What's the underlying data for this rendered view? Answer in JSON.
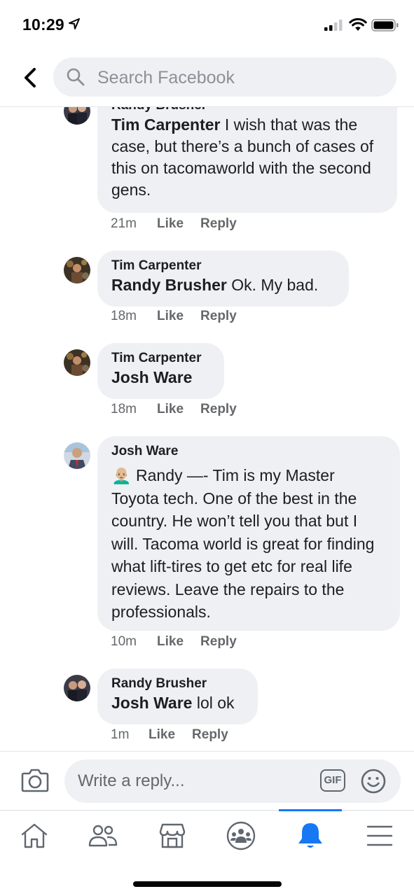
{
  "status": {
    "time": "10:29"
  },
  "search": {
    "placeholder": "Search Facebook"
  },
  "comments": [
    {
      "author": "Randy Brusher",
      "tag": "Tim Carpenter",
      "text": " I wish that was the case, but there’s a bunch of cases of this on tacomaworld with the second gens.",
      "time": "21m",
      "like": "Like",
      "reply": "Reply"
    },
    {
      "author": "Tim Carpenter",
      "tag": "Randy Brusher",
      "text": " Ok. My bad.",
      "time": "18m",
      "like": "Like",
      "reply": "Reply"
    },
    {
      "author": "Tim Carpenter",
      "tag": "Josh Ware",
      "text": "",
      "time": "18m",
      "like": "Like",
      "reply": "Reply"
    },
    {
      "author": "Josh Ware",
      "emoji": "👨🏼‍🦲",
      "text": " Randy —- Tim is my Master Toyota tech. One of the best in the country. He won’t tell you that but I will. Tacoma world is great for finding what lift-tires to get etc for real life reviews. Leave the repairs to the professionals.",
      "time": "10m",
      "like": "Like",
      "reply": "Reply"
    },
    {
      "author": "Randy Brusher",
      "tag": "Josh Ware",
      "text": " lol ok",
      "time": "1m",
      "like": "Like",
      "reply": "Reply"
    }
  ],
  "reply_bar": {
    "placeholder": "Write a reply...",
    "gif_label": "GIF"
  },
  "tabs": [
    "home-icon",
    "friends-icon",
    "marketplace-icon",
    "groups-icon",
    "notifications-icon",
    "menu-icon"
  ],
  "colors": {
    "accent": "#1877f2",
    "bubble": "#eff0f3",
    "meta": "#65676b"
  }
}
